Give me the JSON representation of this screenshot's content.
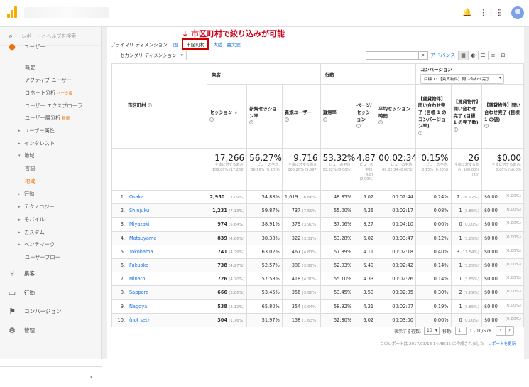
{
  "app": {
    "logo": "analytics-logo",
    "account": ""
  },
  "topbar": {
    "icons": [
      "bell-icon",
      "apps-grid-icon",
      "more-vert-icon"
    ]
  },
  "sidebar": {
    "search_placeholder": "レポートとヘルプを検索",
    "audience": "ユーザー",
    "items": [
      "概要",
      "アクティブ ユーザー",
      "コホート分析",
      "ユーザー エクスプローラ",
      "ユーザー層分析",
      "ユーザー属性",
      "インタレスト",
      "地域",
      "言語",
      "地域",
      "行動",
      "テクノロジー",
      "モバイル",
      "カスタム",
      "ベンチマーク",
      "ユーザーフロー"
    ],
    "beta": "ベータ版",
    "new": "新規",
    "acquisition": "集客",
    "behavior": "行動",
    "conversions": "コンバージョン",
    "admin": "管理"
  },
  "annotation": "↓ 市区町村で絞り込みが可能",
  "primary": {
    "label": "プライマリ ディメンション:",
    "country": "国",
    "city": "市区町村",
    "continent": "大陸",
    "subcontinent": "亜大陸"
  },
  "secondary_dim": "セカンダリ ディメンション",
  "advanced": "アドバンス",
  "table": {
    "groups": {
      "acquisition": "集客",
      "behavior": "行動",
      "conversion": "コンバージョン",
      "goal_select": "目標 1: 【賃貸物件】問い合わせ完了"
    },
    "dim_header": "市区町村",
    "headers": [
      "セッション",
      "新規セッション率",
      "新規ユーザー",
      "直帰率",
      "ページ/セッション",
      "平均セッション時間",
      "【賃貸物件】問い合わせ完了 (目標 1 のコンバージョン率)",
      "【賃貸物件】問い合わせ完了 (目標 1 の完了数)",
      "【賃貸物件】問い合わせ完了 (目標 1 の値)"
    ],
    "totals": [
      {
        "big": "17,266",
        "sm": "全体に対する割合: 100.00% (17,266)"
      },
      {
        "big": "56.27%",
        "sm": "ビューの平均: 56.16% (0.20%)"
      },
      {
        "big": "9,716",
        "sm": "全体に対する割合: 100.20% (9,697)"
      },
      {
        "big": "53.32%",
        "sm": "ビューの平均: 53.32% (0.00%)"
      },
      {
        "big": "4.87",
        "sm": "ビューの平均: 4.87 (0.00%)"
      },
      {
        "big": "00:02:34",
        "sm": "ビューの平均: 00:02:34 (0.00%)"
      },
      {
        "big": "0.15%",
        "sm": "ビューの平均: 0.15% (0.00%)"
      },
      {
        "big": "26",
        "sm": "全体に対する割合: 100.00% (26)"
      },
      {
        "big": "$0.00",
        "sm": "全体に対する割合: 0.00% ($0.00)"
      }
    ],
    "rows": [
      {
        "n": "1.",
        "city": "Osaka",
        "s": "2,950",
        "sp": "(17.09%)",
        "ns": "54.88%",
        "nu": "1,619",
        "nup": "(16.66%)",
        "br": "48.85%",
        "ps": "6.02",
        "dur": "00:02:44",
        "cr": "0.24%",
        "c": "7",
        "cp": "(26.92%)",
        "v": "$0.00",
        "vp": "(0.00%)"
      },
      {
        "n": "2.",
        "city": "Shinjuku",
        "s": "1,231",
        "sp": "(7.13%)",
        "ns": "59.87%",
        "nu": "737",
        "nup": "(7.59%)",
        "br": "55.00%",
        "ps": "4.26",
        "dur": "00:02:17",
        "cr": "0.08%",
        "c": "1",
        "cp": "(3.85%)",
        "v": "$0.00",
        "vp": "(0.00%)"
      },
      {
        "n": "3.",
        "city": "Miyazaki",
        "s": "974",
        "sp": "(5.64%)",
        "ns": "38.91%",
        "nu": "379",
        "nup": "(3.90%)",
        "br": "37.06%",
        "ps": "8.27",
        "dur": "00:04:10",
        "cr": "0.00%",
        "c": "0",
        "cp": "(0.00%)",
        "v": "$0.00",
        "vp": "(0.00%)"
      },
      {
        "n": "4.",
        "city": "Matsuyama",
        "s": "839",
        "sp": "(4.86%)",
        "ns": "38.38%",
        "nu": "322",
        "nup": "(3.31%)",
        "br": "53.28%",
        "ps": "6.02",
        "dur": "00:03:47",
        "cr": "0.12%",
        "c": "1",
        "cp": "(3.85%)",
        "v": "$0.00",
        "vp": "(0.00%)"
      },
      {
        "n": "5.",
        "city": "Yokohama",
        "s": "741",
        "sp": "(4.29%)",
        "ns": "63.02%",
        "nu": "467",
        "nup": "(4.81%)",
        "br": "57.89%",
        "ps": "4.11",
        "dur": "00:02:18",
        "cr": "0.40%",
        "c": "3",
        "cp": "(11.54%)",
        "v": "$0.00",
        "vp": "(0.00%)"
      },
      {
        "n": "6.",
        "city": "Fukuoka",
        "s": "738",
        "sp": "(4.27%)",
        "ns": "52.57%",
        "nu": "388",
        "nup": "(3.99%)",
        "br": "52.03%",
        "ps": "6.40",
        "dur": "00:02:42",
        "cr": "0.14%",
        "c": "1",
        "cp": "(3.85%)",
        "v": "$0.00",
        "vp": "(0.00%)"
      },
      {
        "n": "7.",
        "city": "Minato",
        "s": "726",
        "sp": "(4.20%)",
        "ns": "57.58%",
        "nu": "418",
        "nup": "(4.30%)",
        "br": "55.10%",
        "ps": "4.33",
        "dur": "00:02:26",
        "cr": "0.14%",
        "c": "1",
        "cp": "(3.85%)",
        "v": "$0.00",
        "vp": "(0.00%)"
      },
      {
        "n": "8.",
        "city": "Sapporo",
        "s": "666",
        "sp": "(3.86%)",
        "ns": "53.45%",
        "nu": "356",
        "nup": "(3.66%)",
        "br": "53.45%",
        "ps": "3.50",
        "dur": "00:02:05",
        "cr": "0.30%",
        "c": "2",
        "cp": "(7.69%)",
        "v": "$0.00",
        "vp": "(0.00%)"
      },
      {
        "n": "9.",
        "city": "Nagoya",
        "s": "538",
        "sp": "(3.12%)",
        "ns": "65.80%",
        "nu": "354",
        "nup": "(3.64%)",
        "br": "58.92%",
        "ps": "4.21",
        "dur": "00:02:07",
        "cr": "0.19%",
        "c": "1",
        "cp": "(3.85%)",
        "v": "$0.00",
        "vp": "(0.00%)"
      },
      {
        "n": "10.",
        "city": "(not set)",
        "s": "304",
        "sp": "(1.76%)",
        "ns": "51.97%",
        "nu": "158",
        "nup": "(1.63%)",
        "br": "52.30%",
        "ps": "6.02",
        "dur": "00:03:00",
        "cr": "0.00%",
        "c": "0",
        "cp": "(0.00%)",
        "v": "$0.00",
        "vp": "(0.00%)"
      }
    ]
  },
  "pager": {
    "rows_label": "表示する行数:",
    "rows_value": "10",
    "goto_label": "移動:",
    "goto_value": "1",
    "range": "1 - 10/578"
  },
  "footer": {
    "text": "このレポートは 2017/03/13 14:48:35 に作成されました - ",
    "link": "レポートを更新"
  }
}
